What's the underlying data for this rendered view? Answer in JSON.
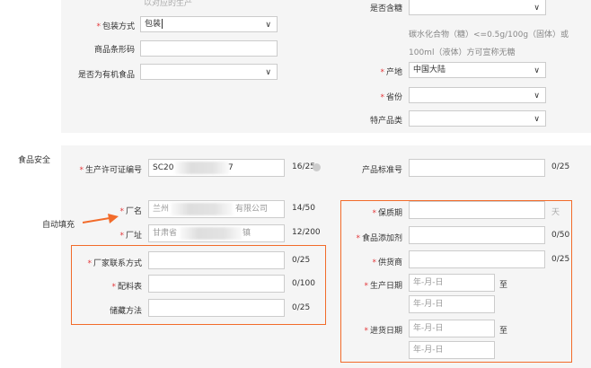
{
  "top_partial": {
    "left_text": "以对应的生产",
    "right_label": "是否含糖"
  },
  "packaging": {
    "label": "包装方式",
    "value": "包装"
  },
  "barcode": {
    "label": "商品条形码",
    "value": ""
  },
  "organic": {
    "label": "是否为有机食品",
    "value": ""
  },
  "sugar_note": {
    "line1": "碳水化合物（糖）<=0.5g/100g（固体）或",
    "line2": "100ml（液体）方可宣称无糖"
  },
  "origin": {
    "label": "产地",
    "value": "中国大陆"
  },
  "province": {
    "label": "省份",
    "value": ""
  },
  "specialty": {
    "label": "特产品类",
    "value": ""
  },
  "section_title": "食品安全",
  "license": {
    "label": "生产许可证编号",
    "value_start": "SC20",
    "value_end": "7",
    "count": "16/25"
  },
  "standard": {
    "label": "产品标准号",
    "value": "",
    "count": "0/25"
  },
  "factory_name": {
    "label": "厂名",
    "value_start": "兰州",
    "value_end": "有限公司",
    "count": "14/50"
  },
  "factory_addr": {
    "label": "厂址",
    "value_start": "甘肃省",
    "value_end": "镇",
    "count": "12/200"
  },
  "autofill_annotation": "自动填充",
  "factory_contact": {
    "label": "厂家联系方式",
    "value": "",
    "count": "0/25"
  },
  "ingredients": {
    "label": "配料表",
    "value": "",
    "count": "0/100"
  },
  "storage": {
    "label": "储藏方法",
    "value": "",
    "count": "0/25"
  },
  "shelf_life": {
    "label": "保质期",
    "value": "",
    "unit": "天"
  },
  "additives": {
    "label": "食品添加剂",
    "value": "",
    "count": "0/50"
  },
  "supplier": {
    "label": "供货商",
    "value": "",
    "count": "0/25"
  },
  "production_date": {
    "label": "生产日期",
    "placeholder": "年-月-日",
    "to": "至"
  },
  "purchase_date": {
    "label": "进货日期",
    "placeholder": "年-月-日",
    "to": "至"
  },
  "colors": {
    "required": "#e4393c",
    "highlight_box": "#f26b2a",
    "panel": "#f5f5f5"
  }
}
